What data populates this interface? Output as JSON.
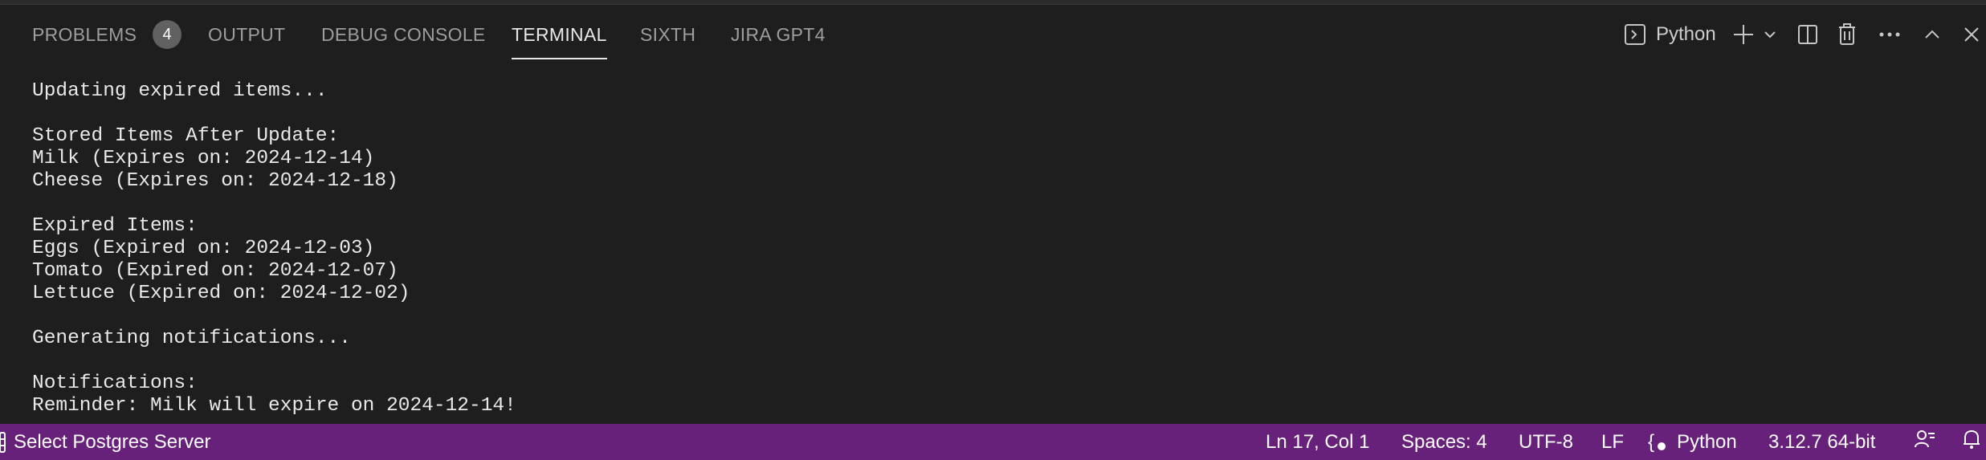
{
  "tabs": {
    "problems": {
      "label": "PROBLEMS",
      "count": "4"
    },
    "output": {
      "label": "OUTPUT"
    },
    "debug_console": {
      "label": "DEBUG CONSOLE"
    },
    "terminal": {
      "label": "TERMINAL"
    },
    "sixth": {
      "label": "SIXTH"
    },
    "jira_gpt4": {
      "label": "JIRA GPT4"
    },
    "active": "TERMINAL"
  },
  "actions": {
    "terminal_profile": {
      "label": "Python",
      "icon": "terminal-icon"
    },
    "new_terminal": {
      "icon": "plus-icon"
    },
    "launch_profile": {
      "icon": "chevron-down-icon"
    },
    "split_terminal": {
      "icon": "split-icon"
    },
    "kill_terminal": {
      "icon": "trash-icon"
    },
    "more_actions": {
      "icon": "ellipsis-icon"
    },
    "maximize_panel": {
      "icon": "chevron-up-icon"
    },
    "close_panel": {
      "icon": "close-icon"
    }
  },
  "terminal": {
    "lines": [
      "Updating expired items...",
      "",
      "Stored Items After Update:",
      "Milk (Expires on: 2024-12-14)",
      "Cheese (Expires on: 2024-12-18)",
      "",
      "Expired Items:",
      "Eggs (Expired on: 2024-12-03)",
      "Tomato (Expired on: 2024-12-07)",
      "Lettuce (Expired on: 2024-12-02)",
      "",
      "Generating notifications...",
      "",
      "Notifications:",
      "Reminder: Milk will expire on 2024-12-14!"
    ]
  },
  "statusbar": {
    "postgres": "Select Postgres Server",
    "cursor_position": "Ln 17, Col 1",
    "indentation": "Spaces: 4",
    "encoding": "UTF-8",
    "line_ending": "LF",
    "language": "Python",
    "interpreter": "3.12.7 64-bit",
    "feedback_icon": "feedback-icon",
    "notifications_icon": "bell-icon"
  },
  "colors": {
    "panel_bg": "#1e1e1e",
    "statusbar_bg": "#68217a",
    "active_tab": "#e7e7e7",
    "inactive_tab": "#9d9d9d",
    "badge_bg": "#616161"
  }
}
